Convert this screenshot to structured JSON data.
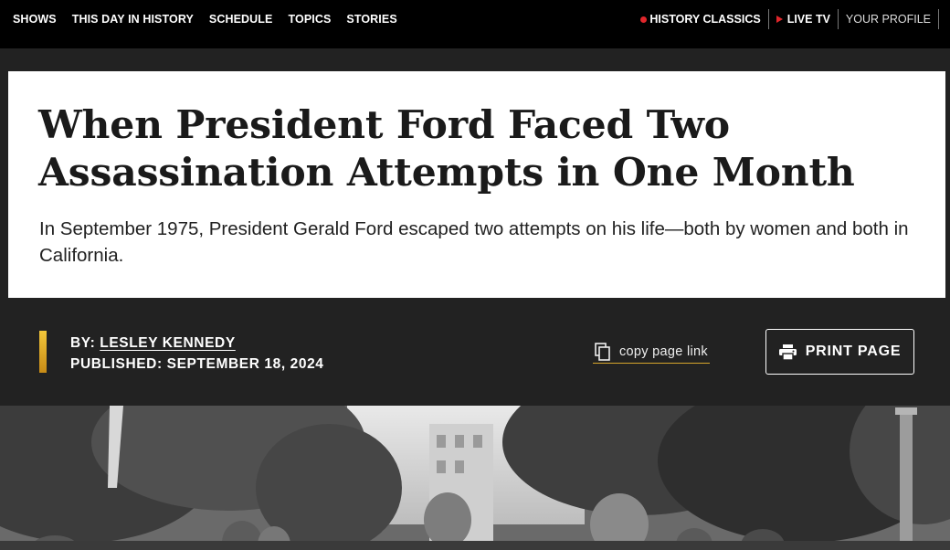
{
  "nav": {
    "left": [
      "SHOWS",
      "THIS DAY IN HISTORY",
      "SCHEDULE",
      "TOPICS",
      "STORIES"
    ],
    "history_classics": "HISTORY CLASSICS",
    "live_tv": "LIVE TV",
    "profile": "YOUR PROFILE"
  },
  "article": {
    "headline": "When President Ford Faced Two Assassination Attempts in One Month",
    "dek": "In September 1975, President Gerald Ford escaped two attempts on his life—both by women and both in California.",
    "by_label": "BY: ",
    "author": "LESLEY KENNEDY",
    "published": "PUBLISHED: SEPTEMBER 18, 2024"
  },
  "actions": {
    "copy_link": "copy page link",
    "print": "PRINT PAGE"
  },
  "icons": {
    "history_classics": "red-dot-icon",
    "live_tv": "play-icon",
    "copy": "copy-icon",
    "print": "printer-icon"
  },
  "colors": {
    "nav_bg": "#000000",
    "band_bg": "#222222",
    "accent_red": "#e0262b",
    "accent_gold": "#d6a52c"
  }
}
